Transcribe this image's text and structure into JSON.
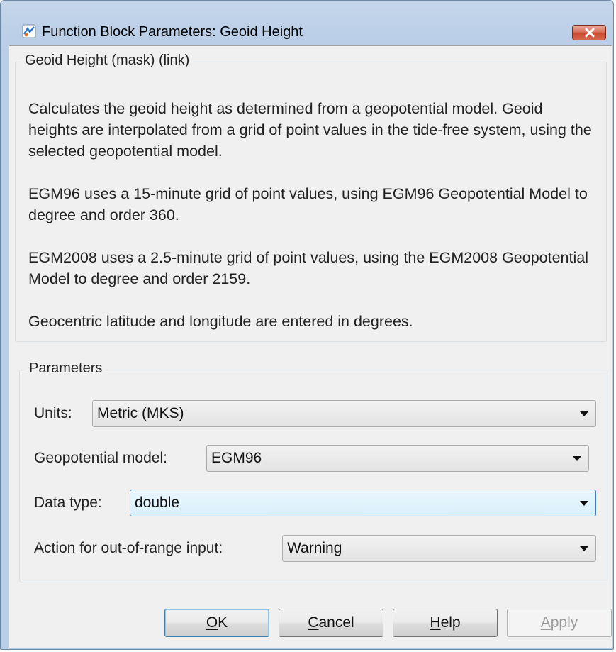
{
  "window": {
    "title": "Function Block Parameters: Geoid Height"
  },
  "description_group": {
    "legend": "Geoid Height (mask) (link)",
    "paragraphs": [
      "Calculates the geoid height as determined from a geopotential model. Geoid heights are interpolated from a grid of point values in the tide-free system, using the selected geopotential model.",
      "EGM96 uses a 15-minute grid of point values, using EGM96 Geopotential Model to degree and order 360.",
      "EGM2008 uses a 2.5-minute grid of point values, using the EGM2008 Geopotential Model to degree and order 2159.",
      "Geocentric latitude and longitude are entered in degrees."
    ]
  },
  "parameters_group": {
    "legend": "Parameters",
    "fields": [
      {
        "label": "Units:",
        "value": "Metric (MKS)"
      },
      {
        "label": "Geopotential model:",
        "value": "EGM96"
      },
      {
        "label": "Data type:",
        "value": "double"
      },
      {
        "label": "Action for out-of-range input:",
        "value": "Warning"
      }
    ]
  },
  "buttons": {
    "ok": {
      "mnemonic": "O",
      "rest": "K"
    },
    "cancel": {
      "mnemonic": "C",
      "rest": "ancel"
    },
    "help": {
      "mnemonic": "H",
      "rest": "elp"
    },
    "apply": {
      "mnemonic": "A",
      "rest": "pply"
    }
  },
  "colors": {
    "title_bar": "#b8cde6",
    "close_button": "#c74a30",
    "focus_border": "#3c7fb1"
  },
  "icons": [
    "simulink-block-icon",
    "close-x-icon",
    "chevron-down-icon"
  ]
}
